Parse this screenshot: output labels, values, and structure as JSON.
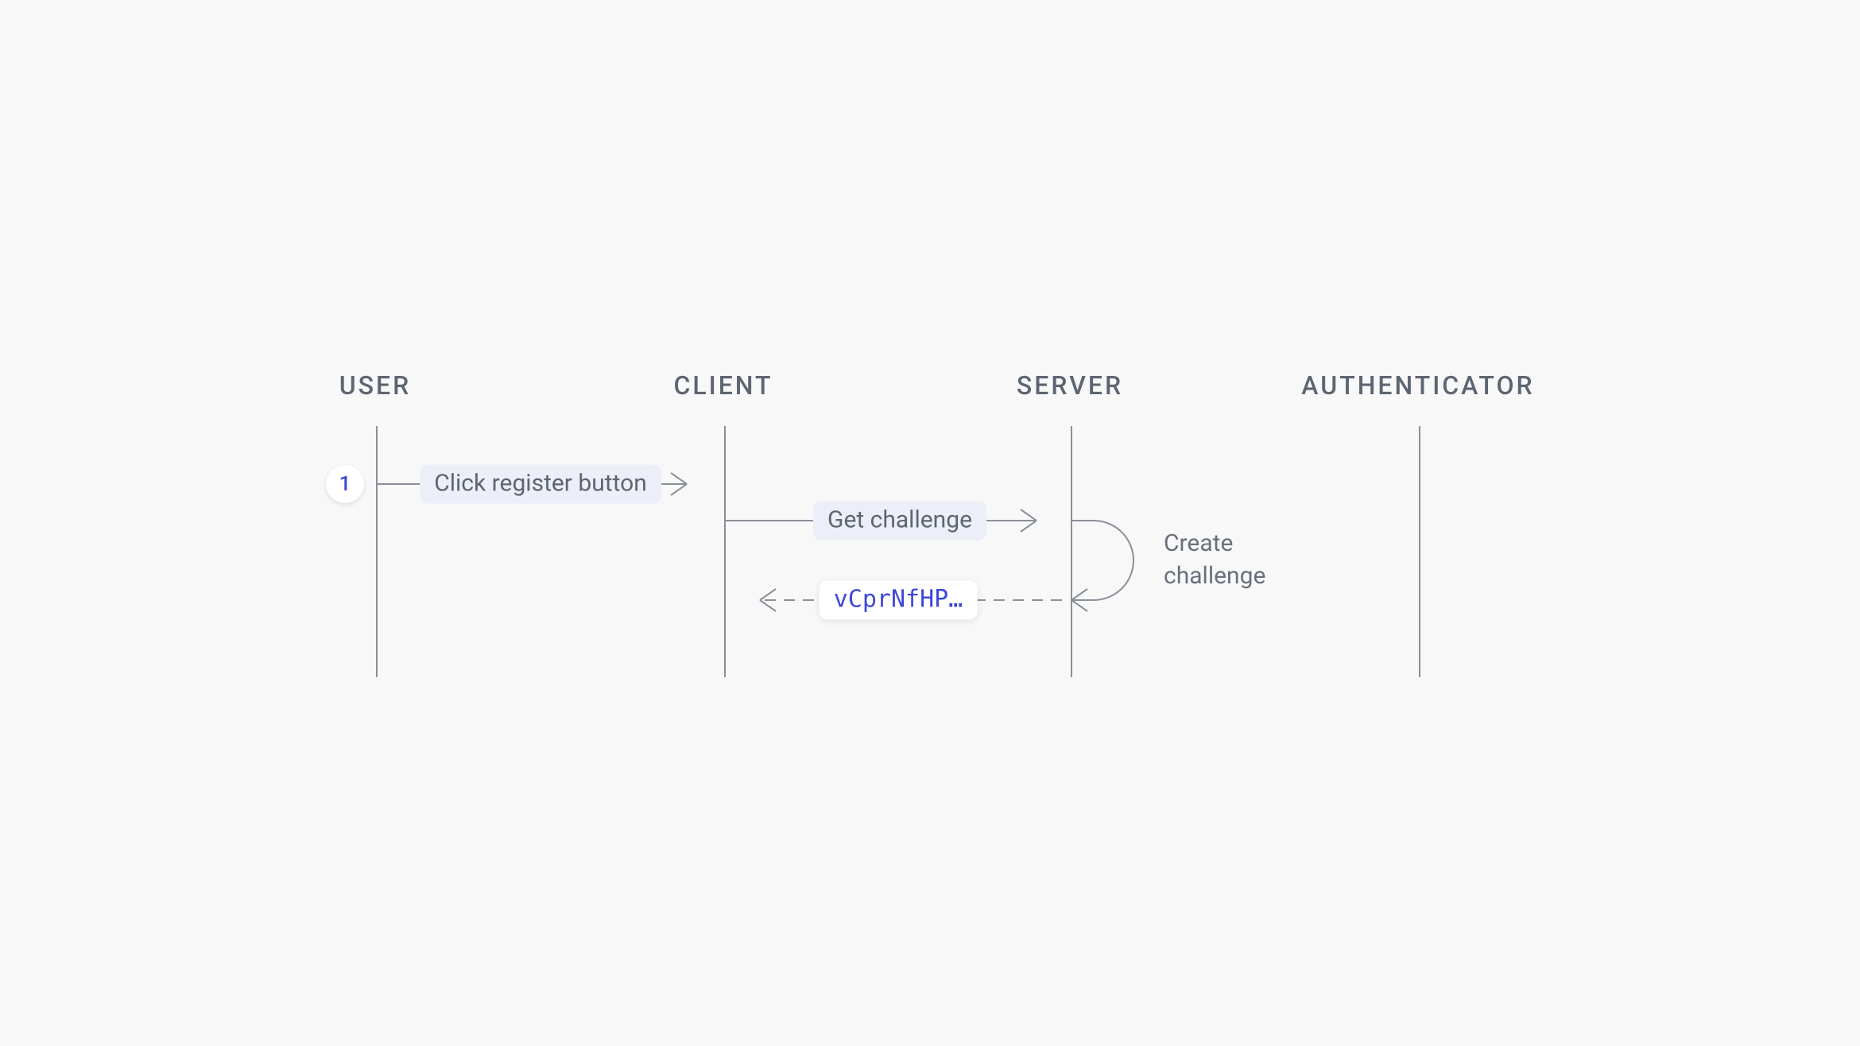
{
  "lanes": {
    "user": "USER",
    "client": "CLIENT",
    "server": "SERVER",
    "authenticator": "AUTHENTICATOR"
  },
  "step": {
    "number": "1"
  },
  "messages": {
    "click_register": "Click register button",
    "get_challenge": "Get challenge",
    "challenge_token": "vCprNfHP…"
  },
  "notes": {
    "create_challenge": "Create\nchallenge"
  },
  "colors": {
    "background": "#f8f8f9",
    "line": "#8a8f99",
    "text": "#5e6572",
    "accent": "#3d47d9",
    "pill_bg": "#eceef8",
    "white": "#ffffff"
  }
}
